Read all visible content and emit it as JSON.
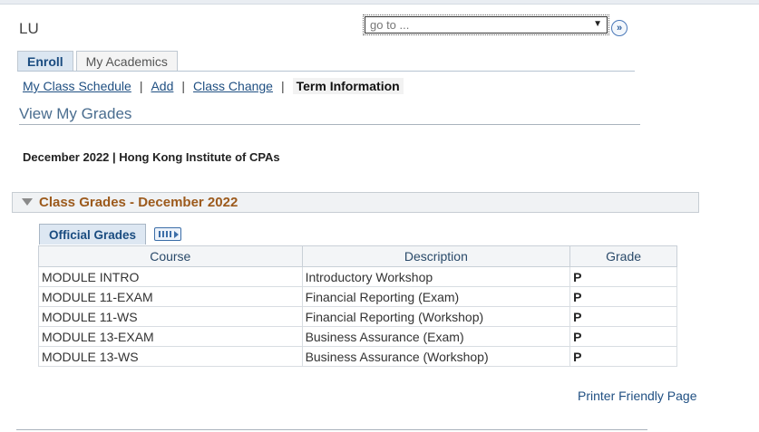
{
  "header": {
    "user": "LU",
    "goto_value": "go to ..."
  },
  "tabs": [
    {
      "label": "Enroll",
      "active": true
    },
    {
      "label": "My Academics",
      "active": false
    }
  ],
  "subnav": {
    "items": [
      {
        "label": "My Class Schedule"
      },
      {
        "label": "Add"
      },
      {
        "label": "Class Change"
      },
      {
        "label": "Term Information"
      }
    ],
    "separator": "|"
  },
  "page_title": "View My Grades",
  "term": "December 2022 | Hong Kong Institute of CPAs",
  "section": {
    "title": "Class Grades - December 2022"
  },
  "grades_tab": "Official Grades",
  "table": {
    "headers": [
      "Course",
      "Description",
      "Grade"
    ],
    "rows": [
      [
        "MODULE INTRO",
        "Introductory Workshop",
        "P"
      ],
      [
        "MODULE 11-EXAM",
        "Financial Reporting (Exam)",
        "P"
      ],
      [
        "MODULE 11-WS",
        "Financial Reporting (Workshop)",
        "P"
      ],
      [
        "MODULE 13-EXAM",
        "Business Assurance (Exam)",
        "P"
      ],
      [
        "MODULE 13-WS",
        "Business Assurance (Workshop)",
        "P"
      ]
    ]
  },
  "footer": {
    "printer_link": "Printer Friendly Page"
  },
  "icons": {
    "go": "double-chevron-right-icon",
    "collapse": "triangle-down-icon",
    "grid": "grid-view-icon"
  }
}
